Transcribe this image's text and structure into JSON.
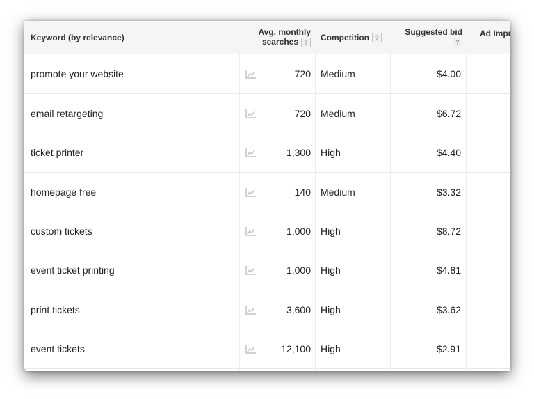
{
  "table": {
    "headers": {
      "keyword": "Keyword (by relevance)",
      "avg_monthly_line1": "Avg. monthly",
      "avg_monthly_line2": "searches",
      "competition": "Competition",
      "suggested_bid": "Suggested bid",
      "ad_impr": "Ad Impr",
      "help_glyph": "?"
    },
    "rows": [
      {
        "keyword": "promote your website",
        "searches": "720",
        "competition": "Medium",
        "bid": "$4.00"
      },
      {
        "keyword": "email retargeting",
        "searches": "720",
        "competition": "Medium",
        "bid": "$6.72"
      },
      {
        "keyword": "ticket printer",
        "searches": "1,300",
        "competition": "High",
        "bid": "$4.40"
      },
      {
        "keyword": "homepage free",
        "searches": "140",
        "competition": "Medium",
        "bid": "$3.32"
      },
      {
        "keyword": "custom tickets",
        "searches": "1,000",
        "competition": "High",
        "bid": "$8.72"
      },
      {
        "keyword": "event ticket printing",
        "searches": "1,000",
        "competition": "High",
        "bid": "$4.81"
      },
      {
        "keyword": "print tickets",
        "searches": "3,600",
        "competition": "High",
        "bid": "$3.62"
      },
      {
        "keyword": "event tickets",
        "searches": "12,100",
        "competition": "High",
        "bid": "$2.91"
      }
    ]
  },
  "icons": {
    "trend": "trend-chart-icon",
    "help": "help-question-icon"
  },
  "colors": {
    "header_bg": "#f5f5f5",
    "text": "#222222",
    "icon": "#bdbdbd"
  }
}
